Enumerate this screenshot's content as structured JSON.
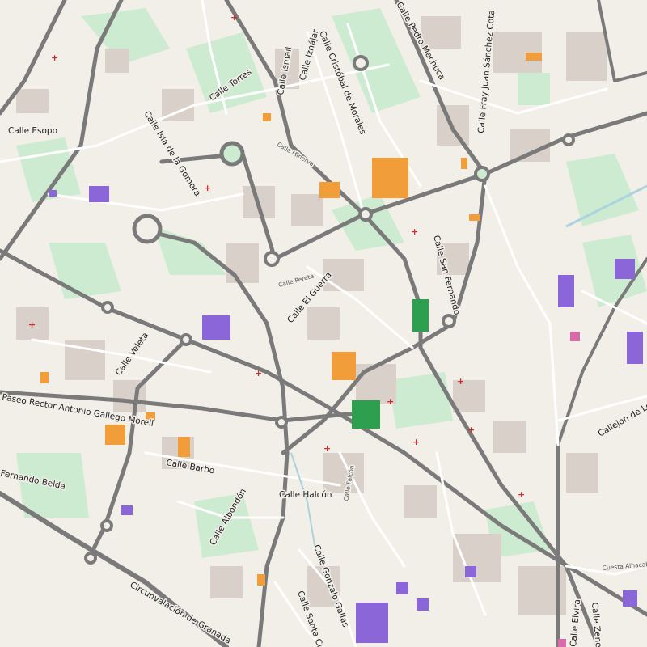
{
  "map": {
    "colors": {
      "background": "#f2efe9",
      "park": "#cdebd0",
      "block": "#d9d0c9",
      "road_main": "#7a7a7a",
      "road_secondary": "#ffffff",
      "water": "#aad3df",
      "school": "#8b66d8",
      "commercial": "#f09d3a",
      "hospital": "#2e9e4f",
      "pharmacy": "#d12b2b"
    },
    "street_labels": [
      {
        "text": "Calle Esopo"
      },
      {
        "text": "Calle Torres"
      },
      {
        "text": "Calle Ismail"
      },
      {
        "text": "Calle Iznájar"
      },
      {
        "text": "Calle Cristóbal de Morales"
      },
      {
        "text": "Calle Pedro Machuca"
      },
      {
        "text": "Calle Fray Juan Sánchez Cota"
      },
      {
        "text": "Calle Isla de la Gomera"
      },
      {
        "text": "Calle Minerva"
      },
      {
        "text": "Calle Perete"
      },
      {
        "text": "Calle El Guerra"
      },
      {
        "text": "Calle San Fernando"
      },
      {
        "text": "Calle Veleta"
      },
      {
        "text": "Paseo Rector Antonio Gallego Morell"
      },
      {
        "text": "Calle Barbo"
      },
      {
        "text": "Fernando Belda"
      },
      {
        "text": "Calle Albondón"
      },
      {
        "text": "Calle Halcón"
      },
      {
        "text": "Calle Falcón"
      },
      {
        "text": "Circunvalación de Granada"
      },
      {
        "text": "Calle Gonzalo Gallas"
      },
      {
        "text": "Calle Santa Clotilde"
      },
      {
        "text": "Calle Elvira"
      },
      {
        "text": "Calle Zenete"
      },
      {
        "text": "Callejón de Lebrija"
      },
      {
        "text": "Cuesta Alhacaba"
      }
    ]
  }
}
